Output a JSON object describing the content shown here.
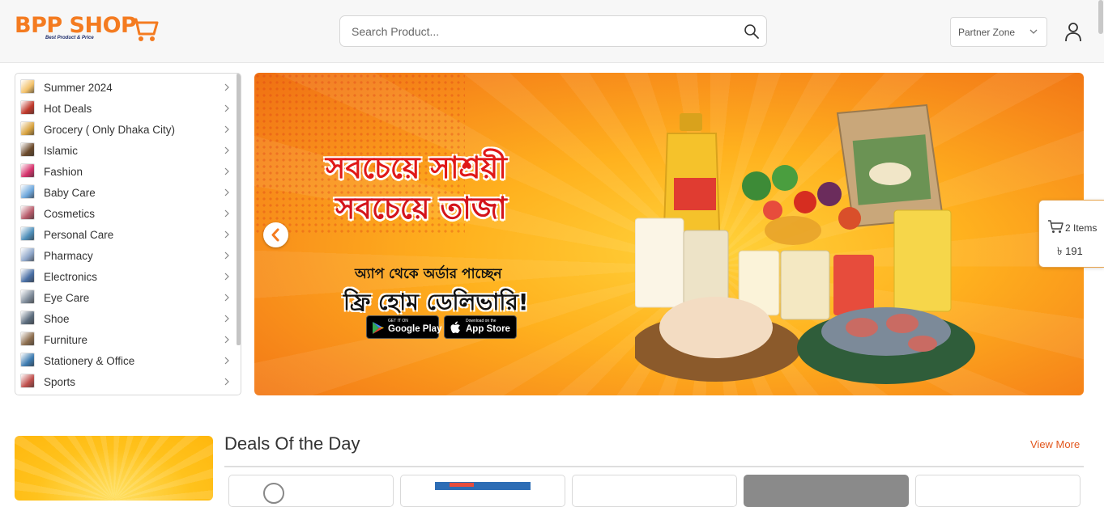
{
  "header": {
    "logo_text": "BPP SHOP",
    "logo_tagline": "Best Product & Price",
    "search_placeholder": "Search Product...",
    "partner_zone_label": "Partner Zone"
  },
  "categories": [
    {
      "label": "Summer 2024",
      "icon": "summer-thumb",
      "color": "#f3c26b"
    },
    {
      "label": "Hot Deals",
      "icon": "hot-deals-thumb",
      "color": "#c0392b"
    },
    {
      "label": "Grocery ( Only Dhaka City)",
      "icon": "grocery-thumb",
      "color": "#d9a441"
    },
    {
      "label": "Islamic",
      "icon": "islamic-thumb",
      "color": "#6b4a2b"
    },
    {
      "label": "Fashion",
      "icon": "fashion-thumb",
      "color": "#d6336c"
    },
    {
      "label": "Baby Care",
      "icon": "baby-care-thumb",
      "color": "#6fa8dc"
    },
    {
      "label": "Cosmetics",
      "icon": "cosmetics-thumb",
      "color": "#b85c6b"
    },
    {
      "label": "Personal Care",
      "icon": "personal-care-thumb",
      "color": "#4f8fba"
    },
    {
      "label": "Pharmacy",
      "icon": "pharmacy-thumb",
      "color": "#8fa7c9"
    },
    {
      "label": "Electronics",
      "icon": "electronics-thumb",
      "color": "#4a6fa5"
    },
    {
      "label": "Eye Care",
      "icon": "eye-care-thumb",
      "color": "#7f8c9a"
    },
    {
      "label": "Shoe",
      "icon": "shoe-thumb",
      "color": "#5d6d7e"
    },
    {
      "label": "Furniture",
      "icon": "furniture-thumb",
      "color": "#8d6e4f"
    },
    {
      "label": "Stationery & Office",
      "icon": "stationery-thumb",
      "color": "#3e7cb1"
    },
    {
      "label": "Sports",
      "icon": "sports-thumb",
      "color": "#c0504d"
    }
  ],
  "banner": {
    "line1": "সবচেয়ে সাশ্রয়ী",
    "line2": "সবচেয়ে তাজা",
    "line3": "অ্যাপ থেকে অর্ডার পাচ্ছেন",
    "line4": "ফ্রি হোম ডেলিভারি!",
    "google_play_small": "GET IT ON",
    "google_play_big": "Google Play",
    "app_store_small": "Download on the",
    "app_store_big": "App Store"
  },
  "mini_cart": {
    "items_label": "2 Items",
    "total": "৳ 191"
  },
  "deals": {
    "title": "Deals Of the Day",
    "view_more": "View More"
  },
  "colors": {
    "brand_orange": "#f47b20",
    "link_orange": "#e2561c"
  }
}
